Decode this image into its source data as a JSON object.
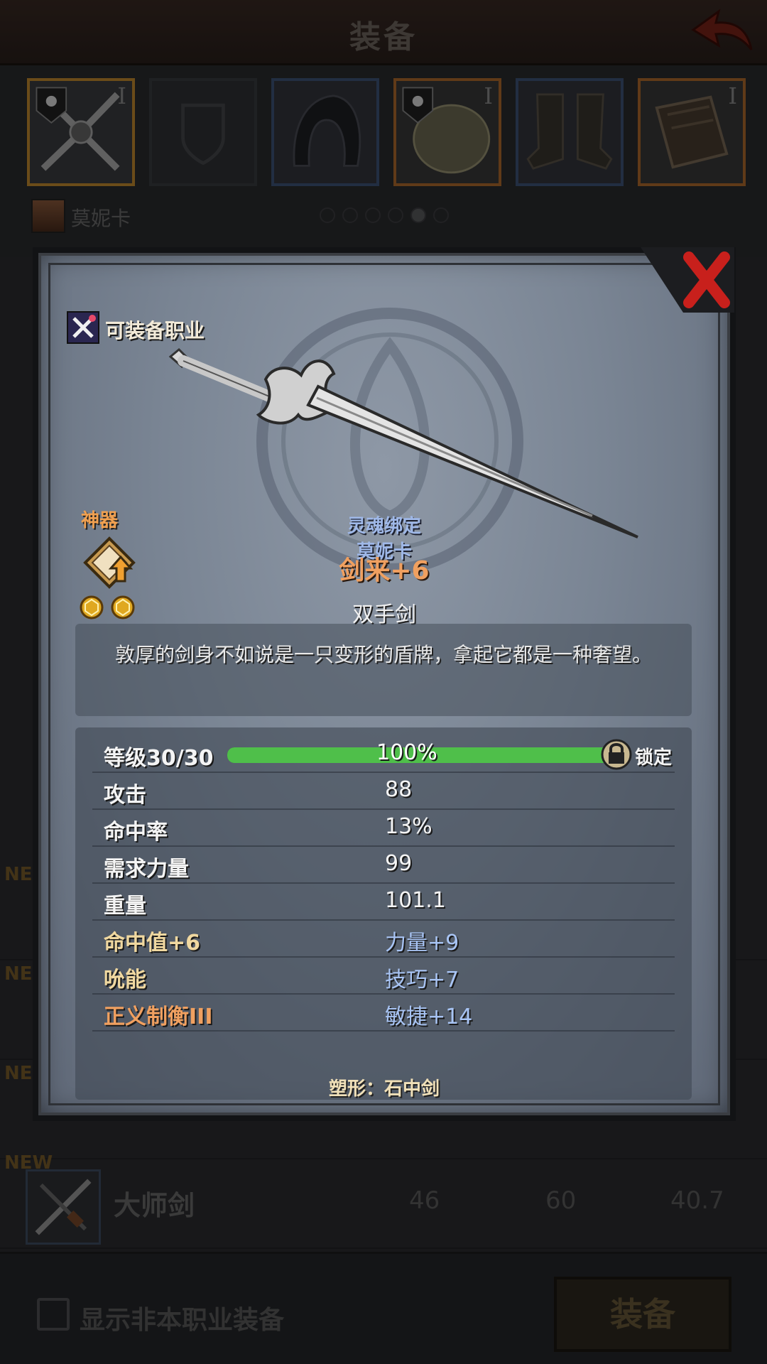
{
  "header": {
    "title": "装备"
  },
  "equipment_slots": [
    {
      "name": "weapon",
      "tier": "I",
      "border": "#c48a2e",
      "bg": "#3b3c40"
    },
    {
      "name": "shield",
      "tier": "",
      "border": "#3a3c41",
      "bg": "#303236"
    },
    {
      "name": "helmet",
      "tier": "",
      "border": "#3f5478",
      "bg": "#33363c"
    },
    {
      "name": "armor",
      "tier": "I",
      "border": "#b06a2c",
      "bg": "#3a3a3a"
    },
    {
      "name": "boots",
      "tier": "",
      "border": "#3f5478",
      "bg": "#33363c"
    },
    {
      "name": "book",
      "tier": "I",
      "border": "#b06a2c",
      "bg": "#3a3a3a"
    }
  ],
  "character": {
    "name": "莫妮卡"
  },
  "item_list": [
    {
      "new": "NEW",
      "name": "",
      "v1": "",
      "v2": "",
      "v3": ""
    },
    {
      "new": "NEW",
      "name": "",
      "v1": "",
      "v2": "",
      "v3": ""
    },
    {
      "new": "NEW",
      "name": "",
      "v1": "",
      "v2": "",
      "v3": ""
    },
    {
      "new": "NEW",
      "name": "大师剑",
      "v1": "46",
      "v2": "60",
      "v3": "40.7"
    }
  ],
  "bottom": {
    "checkbox_label": "显示非本职业装备",
    "equip_button": "装备"
  },
  "popup": {
    "class_label": "可装备职业",
    "artifact_label": "神器",
    "bound_line1": "灵魂绑定",
    "bound_line2": "莫妮卡",
    "item_name": "剑来+6",
    "item_type": "双手剑",
    "description": "敦厚的剑身不如说是一只变形的盾牌，拿起它都是一种奢望。",
    "level": {
      "label": "等级",
      "value": "30/30",
      "percent": "100%",
      "fill": 1.0,
      "lock_label": "锁定"
    },
    "stats": [
      {
        "left": "攻击",
        "right": "88"
      },
      {
        "left": "命中率",
        "right": "13%"
      },
      {
        "left": "需求力量",
        "right": "99"
      },
      {
        "left": "重量",
        "right": "101.1"
      }
    ],
    "bonuses": [
      {
        "left": "命中值+6",
        "right": "力量+9"
      },
      {
        "left": "吮能",
        "right": "技巧+7"
      },
      {
        "left": "正义制衡III",
        "right": "敏捷+14"
      }
    ],
    "mold": "塑形：石中剑"
  },
  "colors": {
    "accent_gold": "#c48a2e",
    "bonus_blue": "#a8c4f4",
    "bonus_orange": "#f0a060",
    "level_green": "#4fbf4a",
    "close_red": "#c8201c"
  }
}
